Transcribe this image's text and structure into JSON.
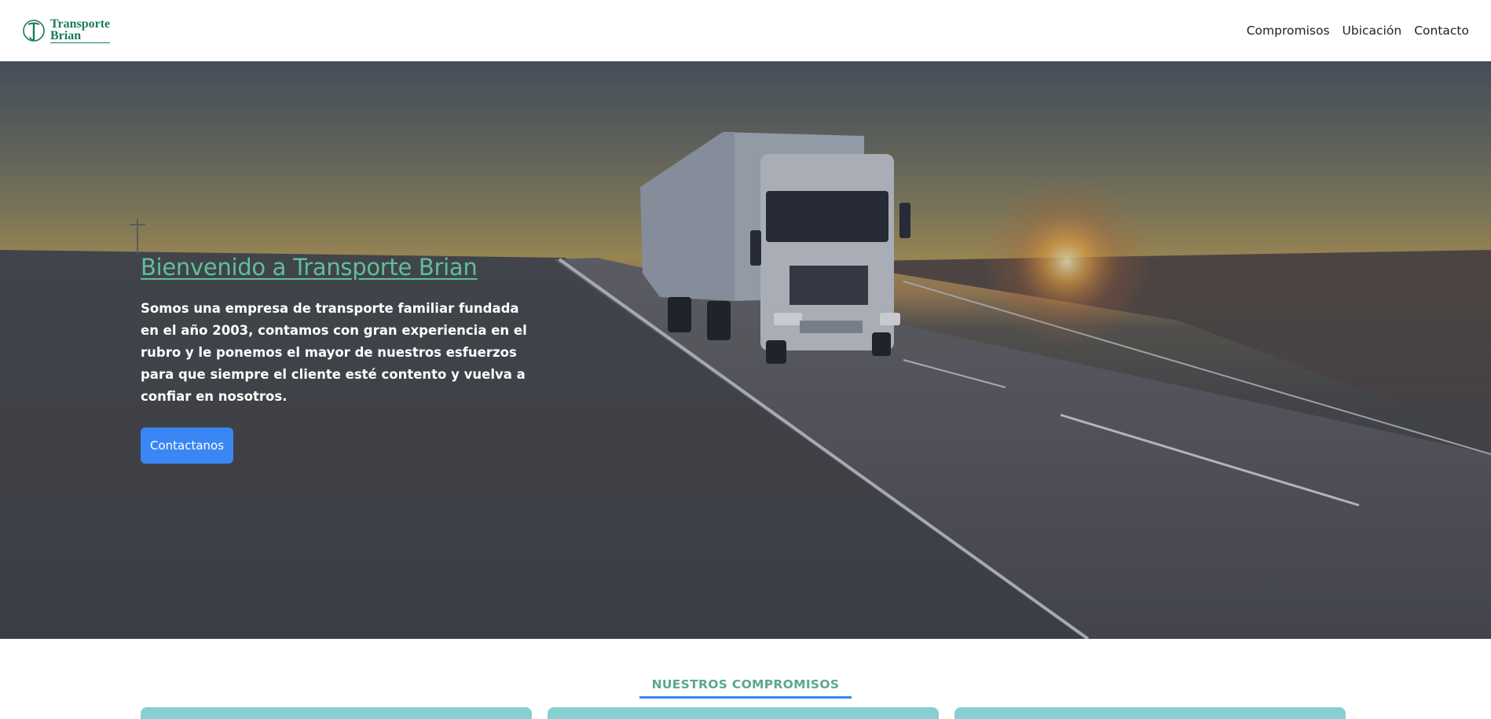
{
  "brand": {
    "line1": "Transporte",
    "line2": "Brian",
    "color": "#1a7a5e"
  },
  "nav": {
    "links": [
      "Compromisos",
      "Ubicación",
      "Contacto"
    ]
  },
  "hero": {
    "title": "Bienvenido a Transporte Brian",
    "description": "Somos una empresa de transporte familiar fundada en el año 2003, contamos con gran experiencia en el rubro y le ponemos el mayor de nuestros esfuerzos para que siempre el cliente esté contento y vuelva a confiar en nosotros.",
    "button_label": "Contactanos",
    "accent_color": "#5fbf9a",
    "button_color": "#3a86f5"
  },
  "section": {
    "title": "NUESTROS COMPROMISOS",
    "card_color": "#86cfd3"
  }
}
